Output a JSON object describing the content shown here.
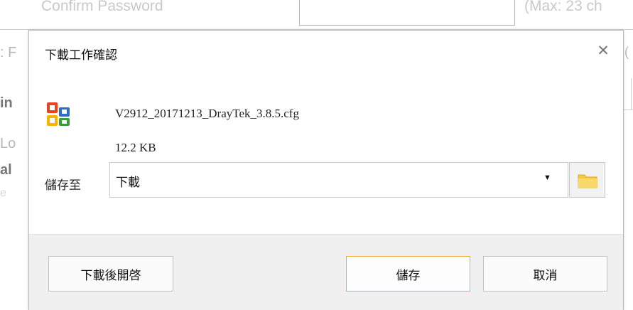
{
  "background": {
    "confirm_label": "Confirm Password",
    "max_label": "(Max: 23 ch",
    "left_fragments": [
      ": F",
      "in",
      "Lo",
      "al",
      "e"
    ],
    "right_fragment": "("
  },
  "dialog": {
    "title": "下載工作確認",
    "close_glyph": "✕",
    "file": {
      "name": "V2912_20171213_DrayTek_3.8.5.cfg",
      "size": "12.2 KB",
      "icon": "office-file-icon"
    },
    "save_to": {
      "label": "儲存至",
      "value": "下載",
      "caret": "▼",
      "browse_icon": "folder-icon"
    },
    "buttons": {
      "open_after_download": "下載後開啓",
      "save": "儲存",
      "cancel": "取消"
    }
  },
  "colors": {
    "save_button_border": "#f1a83d",
    "footer_bg": "#f0f0f0",
    "folder": "#f5c842"
  }
}
